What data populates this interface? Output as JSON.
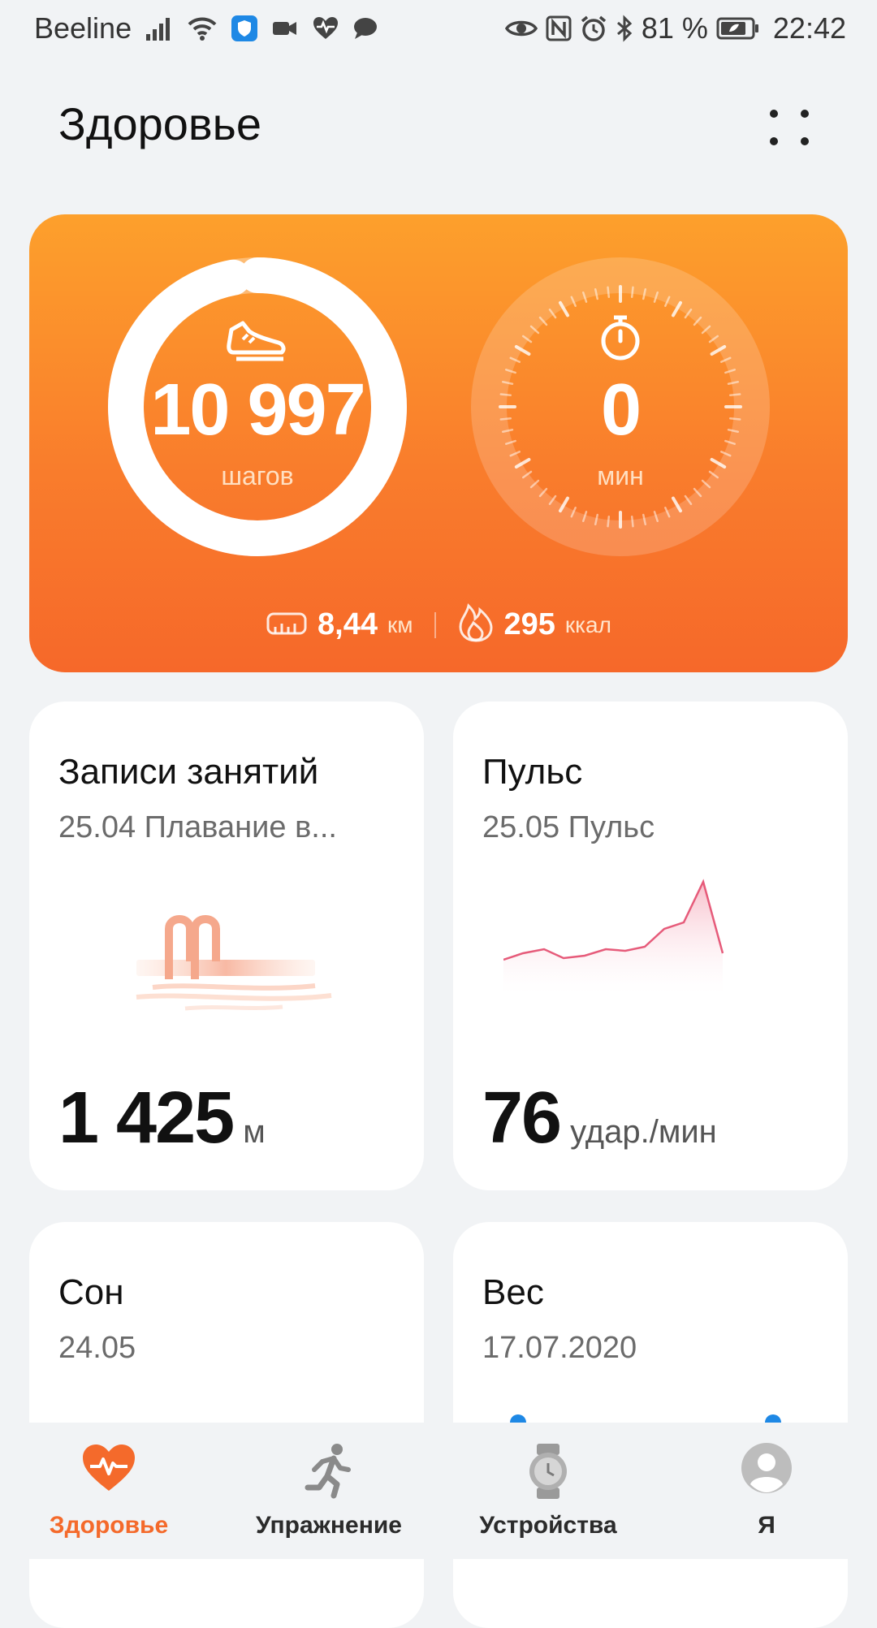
{
  "status_bar": {
    "carrier": "Beeline",
    "battery": "81 %",
    "time": "22:42"
  },
  "header": {
    "title": "Здоровье"
  },
  "activity": {
    "steps_value": "10 997",
    "steps_unit": "шагов",
    "steps_progress": 0.97,
    "minutes_value": "0",
    "minutes_unit": "мин",
    "distance_value": "8,44",
    "distance_unit": "км",
    "calories_value": "295",
    "calories_unit": "ккал",
    "accent": "#f97d2c"
  },
  "cards": {
    "workouts": {
      "title": "Записи занятий",
      "subtitle": "25.04 Плавание в...",
      "value": "1 425",
      "unit": "м"
    },
    "pulse": {
      "title": "Пульс",
      "subtitle": "25.05 Пульс",
      "value": "76",
      "unit": "удар./мин"
    },
    "sleep": {
      "title": "Сон",
      "subtitle": "24.05"
    },
    "weight": {
      "title": "Вес",
      "subtitle": "17.07.2020"
    }
  },
  "bottom_nav": {
    "items": [
      {
        "label": "Здоровье",
        "icon": "heart-pulse-icon",
        "active": true
      },
      {
        "label": "Упражнение",
        "icon": "running-icon",
        "active": false
      },
      {
        "label": "Устройства",
        "icon": "watch-icon",
        "active": false
      },
      {
        "label": "Я",
        "icon": "avatar-icon",
        "active": false
      }
    ],
    "active_color": "#f46a2b"
  }
}
